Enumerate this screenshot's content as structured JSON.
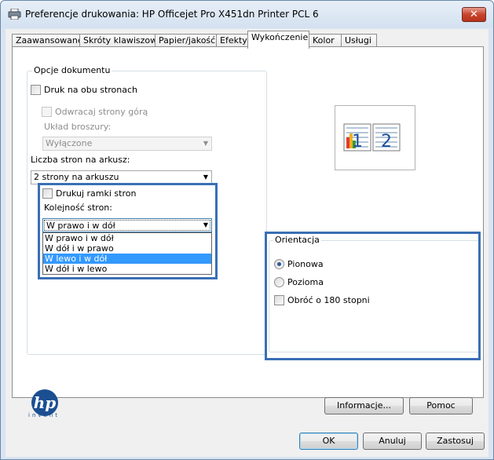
{
  "window": {
    "title": "Preferencje drukowania: HP Officejet Pro X451dn Printer PCL 6",
    "close_label": "✕"
  },
  "tabs": [
    {
      "label": "Zaawansowane"
    },
    {
      "label": "Skróty klawiszowe"
    },
    {
      "label": "Papier/jakość"
    },
    {
      "label": "Efekty"
    },
    {
      "label": "Wykończenie",
      "active": true
    },
    {
      "label": "Kolor"
    },
    {
      "label": "Usługi"
    }
  ],
  "document_options": {
    "group_label": "Opcje dokumentu",
    "duplex_label": "Druk na obu stronach",
    "flip_label": "Odwracaj strony górą",
    "booklet_label": "Układ broszury:",
    "booklet_value": "Wyłączone",
    "pages_per_sheet_label": "Liczba stron na arkusz:",
    "pages_per_sheet_value": "2 strony na arkuszu",
    "borders_label": "Drukuj ramki stron",
    "order_label": "Kolejność stron:",
    "order_value": "W prawo i w dół",
    "order_options": [
      {
        "label": "W prawo i w dół"
      },
      {
        "label": "W dół i w prawo"
      },
      {
        "label": "W lewo i w dół"
      },
      {
        "label": "W dół i w lewo"
      }
    ],
    "order_options_highlighted_index": 2
  },
  "preview": {
    "page_numbers": [
      "1",
      "2"
    ]
  },
  "orientation": {
    "group_label": "Orientacja",
    "portrait_label": "Pionowa",
    "landscape_label": "Pozioma",
    "rotate_label": "Obróć o 180 stopni",
    "selected": "portrait"
  },
  "brand": {
    "logo_text": "hp",
    "tagline": "invent"
  },
  "buttons": {
    "info_label": "Informacje...",
    "help_label": "Pomoc",
    "ok_label": "OK",
    "cancel_label": "Anuluj",
    "apply_label": "Zastosuj"
  },
  "colors": {
    "highlight_border": "#3a6fb5",
    "selected_item_bg": "#3399ff"
  }
}
